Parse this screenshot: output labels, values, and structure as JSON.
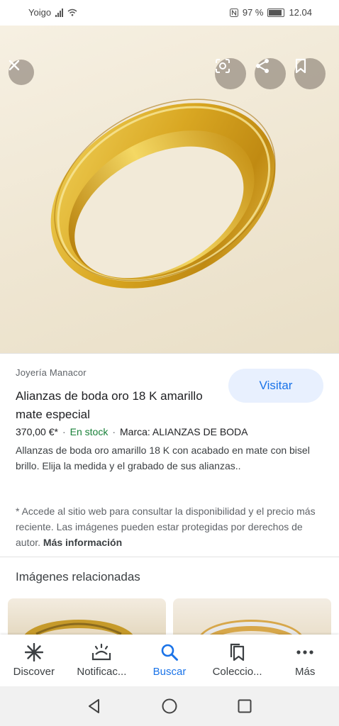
{
  "status_bar": {
    "carrier": "Yoigo",
    "battery": "97 %",
    "time": "12.04"
  },
  "image_viewer": {
    "icons": {
      "close": "close-icon",
      "lens": "google-lens-icon",
      "share": "share-icon",
      "save": "bookmark-icon"
    }
  },
  "product": {
    "merchant": "Joyería Manacor",
    "title": "Alianzas de boda oro 18 K amarillo mate especial",
    "visit_label": "Visitar",
    "price": "370,00 €*",
    "stock": "En stock",
    "brand": "Marca: ALIANZAS DE BODA",
    "description": "Allanzas de boda oro amarillo 18 K con acabado en mate con bisel brillo. Elija la medida y el grabado de sus alianzas..",
    "note": "* Accede al sitio web para consultar la disponibilidad y el precio más reciente. Las imágenes pueden estar protegidas por derechos de autor.",
    "more_info": "Más información"
  },
  "related": {
    "title": "Imágenes relacionadas"
  },
  "bottom_nav": {
    "items": [
      {
        "label": "Discover",
        "icon": "asterisk-icon"
      },
      {
        "label": "Notificac...",
        "icon": "notifications-icon"
      },
      {
        "label": "Buscar",
        "icon": "search-icon"
      },
      {
        "label": "Coleccio...",
        "icon": "collections-icon"
      },
      {
        "label": "Más",
        "icon": "more-icon"
      }
    ],
    "active_index": 2
  },
  "system_nav": {
    "icons": [
      "back-icon",
      "home-icon",
      "recents-icon"
    ]
  },
  "colors": {
    "accent": "#1a73e8",
    "stock_green": "#188038",
    "gold": "#d4a82a"
  }
}
